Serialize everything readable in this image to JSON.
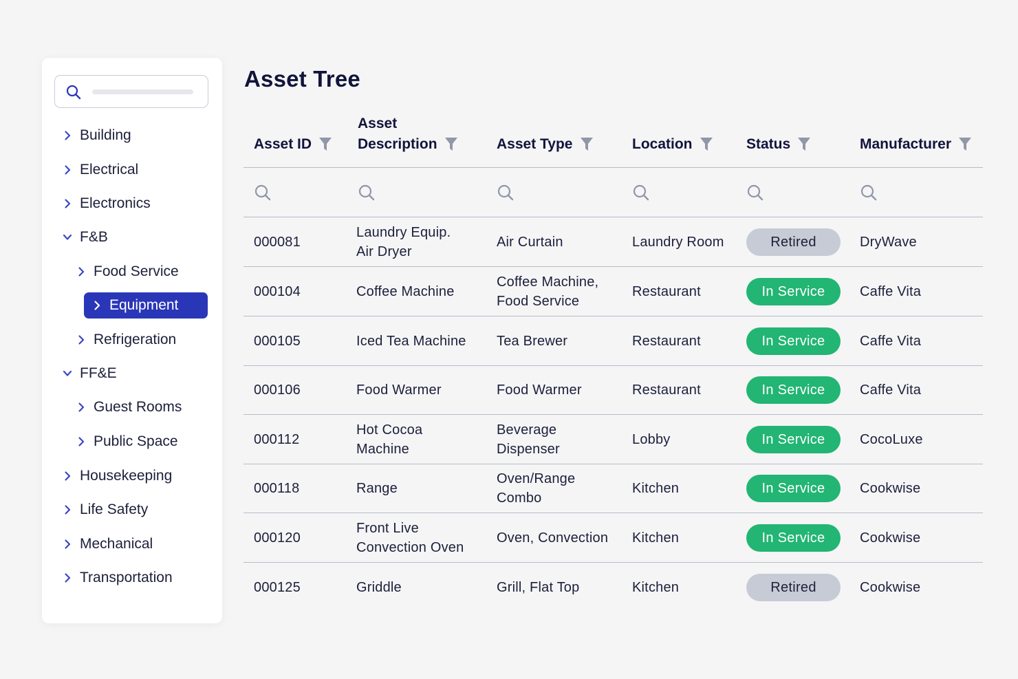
{
  "sidebar": {
    "items": [
      {
        "label": "Building",
        "expanded": false,
        "level": 0
      },
      {
        "label": "Electrical",
        "expanded": false,
        "level": 0
      },
      {
        "label": "Electronics",
        "expanded": false,
        "level": 0
      },
      {
        "label": "F&B",
        "expanded": true,
        "level": 0
      },
      {
        "label": "Food Service",
        "expanded": false,
        "level": 1
      },
      {
        "label": "Equipment",
        "expanded": false,
        "level": 1,
        "selected": true
      },
      {
        "label": "Refrigeration",
        "expanded": false,
        "level": 1
      },
      {
        "label": "FF&E",
        "expanded": true,
        "level": 0
      },
      {
        "label": "Guest Rooms",
        "expanded": false,
        "level": 1
      },
      {
        "label": "Public Space",
        "expanded": false,
        "level": 1
      },
      {
        "label": "Housekeeping",
        "expanded": false,
        "level": 0
      },
      {
        "label": "Life Safety",
        "expanded": false,
        "level": 0
      },
      {
        "label": "Mechanical",
        "expanded": false,
        "level": 0
      },
      {
        "label": "Transportation",
        "expanded": false,
        "level": 0
      }
    ]
  },
  "main": {
    "title": "Asset Tree",
    "columns": [
      {
        "key": "id",
        "label": "Asset ID"
      },
      {
        "key": "desc",
        "label_line1": "Asset",
        "label_line2": "Description"
      },
      {
        "key": "type",
        "label": "Asset Type"
      },
      {
        "key": "location",
        "label": "Location"
      },
      {
        "key": "status",
        "label": "Status"
      },
      {
        "key": "manufacturer",
        "label": "Manufacturer"
      }
    ],
    "rows": [
      {
        "id": "000081",
        "desc": [
          "Laundry Equip.",
          "Air Dryer"
        ],
        "type": [
          "Air Curtain"
        ],
        "location": "Laundry Room",
        "status": "Retired",
        "manufacturer": "DryWave"
      },
      {
        "id": "000104",
        "desc": [
          "Coffee Machine"
        ],
        "type": [
          "Coffee Machine,",
          "Food Service"
        ],
        "location": "Restaurant",
        "status": "In Service",
        "manufacturer": "Caffe Vita"
      },
      {
        "id": "000105",
        "desc": [
          "Iced Tea Machine"
        ],
        "type": [
          "Tea Brewer"
        ],
        "location": "Restaurant",
        "status": "In Service",
        "manufacturer": "Caffe Vita"
      },
      {
        "id": "000106",
        "desc": [
          "Food Warmer"
        ],
        "type": [
          "Food Warmer"
        ],
        "location": "Restaurant",
        "status": "In Service",
        "manufacturer": "Caffe Vita"
      },
      {
        "id": "000112",
        "desc": [
          "Hot Cocoa",
          "Machine"
        ],
        "type": [
          "Beverage",
          "Dispenser"
        ],
        "location": "Lobby",
        "status": "In Service",
        "manufacturer": "CocoLuxe"
      },
      {
        "id": "000118",
        "desc": [
          "Range"
        ],
        "type": [
          "Oven/Range",
          "Combo"
        ],
        "location": "Kitchen",
        "status": "In Service",
        "manufacturer": "Cookwise"
      },
      {
        "id": "000120",
        "desc": [
          "Front Live",
          "Convection Oven"
        ],
        "type": [
          "Oven, Convection"
        ],
        "location": "Kitchen",
        "status": "In Service",
        "manufacturer": "Cookwise"
      },
      {
        "id": "000125",
        "desc": [
          "Griddle"
        ],
        "type": [
          "Grill, Flat Top"
        ],
        "location": "Kitchen",
        "status": "Retired",
        "manufacturer": "Cookwise"
      }
    ]
  },
  "colors": {
    "accent": "#2a36b8",
    "in_service": "#22b573",
    "retired": "#c7cbd5",
    "icon": "#9196a8",
    "chevron": "#3a46c4"
  },
  "icons": {
    "search": "search-icon",
    "filter": "filter-icon",
    "chevron_right": "chevron-right-icon",
    "chevron_down": "chevron-down-icon"
  }
}
